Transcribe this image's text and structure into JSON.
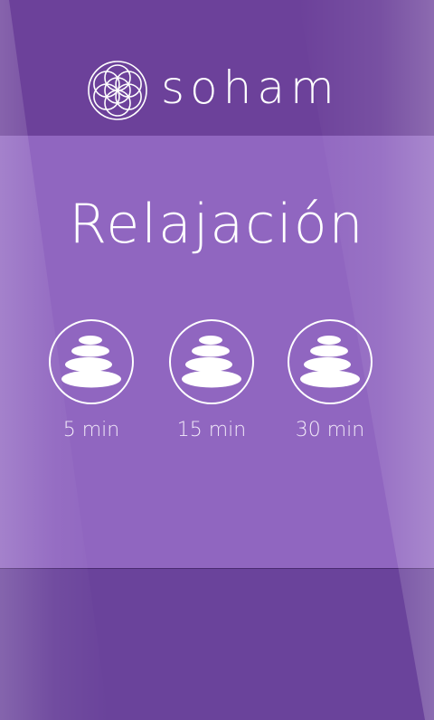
{
  "header": {
    "brand": "soham",
    "logo_icon": "flower-of-life-icon"
  },
  "main": {
    "title": "Relajación",
    "options": [
      {
        "label": "5 min",
        "icon": "stacked-stones-icon"
      },
      {
        "label": "15 min",
        "icon": "stacked-stones-icon"
      },
      {
        "label": "30 min",
        "icon": "stacked-stones-icon"
      }
    ]
  },
  "colors": {
    "header_bg": "#6c419a",
    "panel_bg": "#9066c0",
    "footer_bg": "#6a439b",
    "text": "#ffffff"
  }
}
